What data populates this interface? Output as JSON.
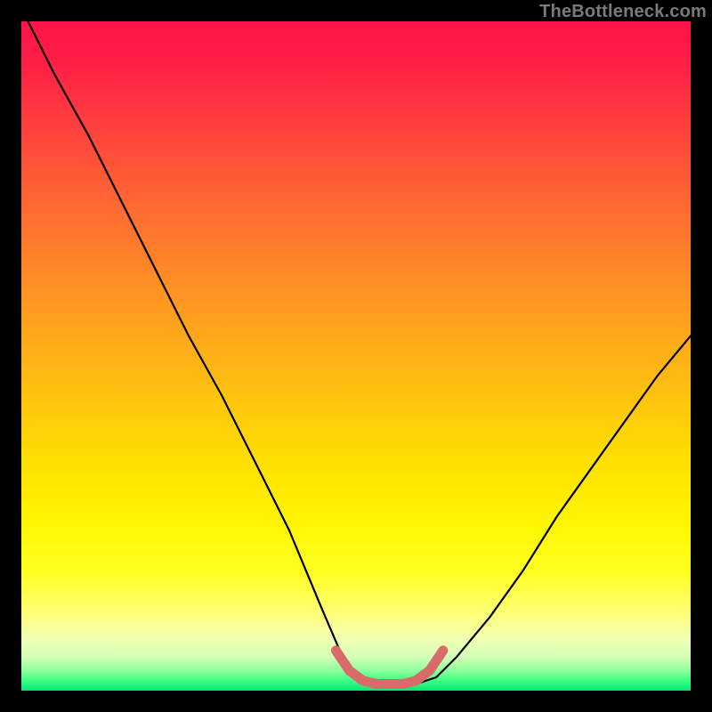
{
  "attribution": "TheBottleneck.com",
  "chart_data": {
    "type": "line",
    "title": "",
    "xlabel": "",
    "ylabel": "",
    "xlim": [
      0,
      100
    ],
    "ylim": [
      0,
      100
    ],
    "series": [
      {
        "name": "curve",
        "x": [
          0,
          5,
          10,
          15,
          20,
          25,
          30,
          35,
          40,
          45,
          48,
          50,
          53,
          56,
          59,
          62,
          65,
          70,
          75,
          80,
          85,
          90,
          95,
          100
        ],
        "values": [
          102,
          92,
          83,
          73,
          63,
          53,
          44,
          34,
          24,
          12,
          5,
          2,
          1,
          1,
          1,
          2,
          5,
          11,
          18,
          26,
          33,
          40,
          47,
          53
        ]
      },
      {
        "name": "highlight",
        "x": [
          47,
          49,
          51,
          53,
          55,
          57,
          59,
          61,
          63
        ],
        "values": [
          6,
          3,
          1.5,
          1,
          1,
          1,
          1.5,
          3,
          6
        ]
      }
    ],
    "colors": {
      "curve": "#000000",
      "highlight": "#d86a6a"
    }
  }
}
